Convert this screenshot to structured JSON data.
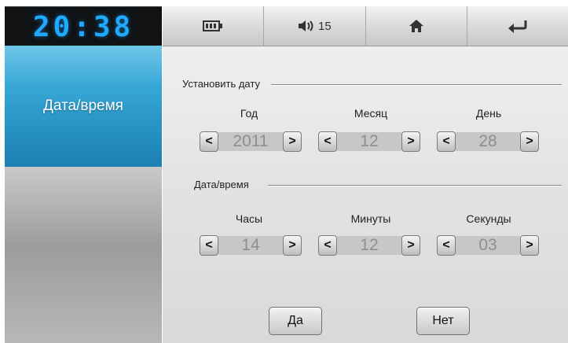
{
  "clock": {
    "time": "20:38"
  },
  "sidebar": {
    "active_item": "Дата/время"
  },
  "topbar": {
    "battery_icon": "battery-icon",
    "volume_icon": "volume-icon",
    "volume_level": "15",
    "home_icon": "home-icon",
    "back_icon": "back-arrow-icon"
  },
  "date_section": {
    "title": "Установить дату",
    "year": {
      "label": "Год",
      "value": "2011"
    },
    "month": {
      "label": "Месяц",
      "value": "12"
    },
    "day": {
      "label": "День",
      "value": "28"
    }
  },
  "time_section": {
    "title": "Дата/время",
    "hours": {
      "label": "Часы",
      "value": "14"
    },
    "minutes": {
      "label": "Минуты",
      "value": "12"
    },
    "seconds": {
      "label": "Секунды",
      "value": "03"
    }
  },
  "spinner": {
    "dec_glyph": "<",
    "inc_glyph": ">"
  },
  "actions": {
    "yes_label": "Да",
    "no_label": "Нет"
  },
  "colors": {
    "accent": "#36a6d6",
    "clock_digits": "#1fa9ff"
  }
}
